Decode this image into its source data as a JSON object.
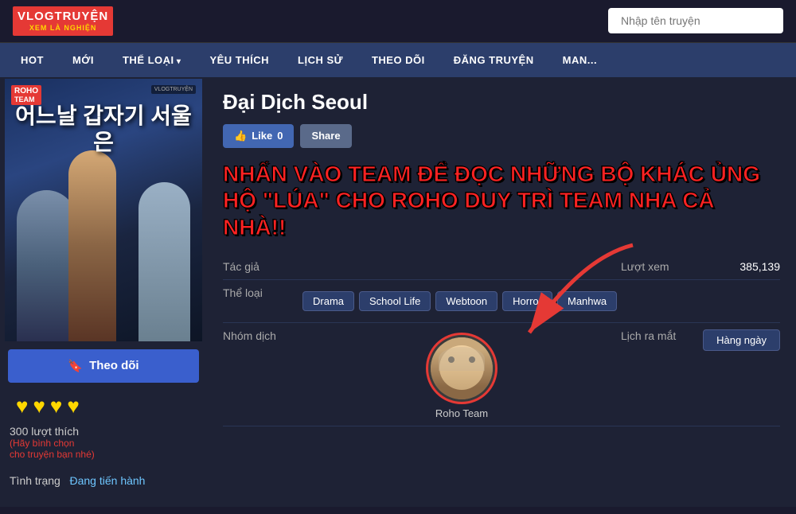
{
  "header": {
    "logo_top": "VLOGTRUYỆN",
    "logo_bottom": "XEM LÀ NGHIỆN",
    "search_placeholder": "Nhập tên truyện"
  },
  "nav": {
    "items": [
      {
        "label": "HOT",
        "has_arrow": false
      },
      {
        "label": "MỚI",
        "has_arrow": false
      },
      {
        "label": "THỂ LOẠI",
        "has_arrow": true
      },
      {
        "label": "YÊU THÍCH",
        "has_arrow": false
      },
      {
        "label": "LỊCH SỬ",
        "has_arrow": false
      },
      {
        "label": "THEO DÕI",
        "has_arrow": false
      },
      {
        "label": "ĐĂNG TRUYỆN",
        "has_arrow": false
      },
      {
        "label": "MAN...",
        "has_arrow": false
      }
    ]
  },
  "manga": {
    "title": "Đại Dịch Seoul",
    "cover_title": "어느날\n갑자기\n서울은",
    "cover_badge_top": "ROHO",
    "cover_badge_bottom": "TEAM",
    "watermark": "VLOGTRUYỆN",
    "like_count": "0",
    "like_label": "Like",
    "share_label": "Share",
    "promo_text": "NHẤN VÀO TEAM ĐỂ ĐỌC NHỮNG BỘ KHÁC ỦNG HỘ \"LÚA\" CHO ROHO DUY TRÌ TEAM NHA CẢ NHÀ!!",
    "author_label": "Tác giả",
    "author_value": "",
    "views_label": "Lượt xem",
    "views_value": "385,139",
    "genre_label": "Thể loại",
    "genres": [
      "Drama",
      "School Life",
      "Webtoon",
      "Horror",
      "Manhwa"
    ],
    "group_label": "Nhóm dịch",
    "group_name": "Roho Team",
    "schedule_label": "Lịch ra mắt",
    "schedule_value": "Hàng ngày",
    "follow_label": "Theo dõi",
    "hearts_count": 4,
    "likes_count": "300 lượt thích",
    "likes_hint": "(Hãy bình chọn\ncho truyện bạn nhé)",
    "status_label": "Tình trạng",
    "status_value": "Đang tiến hành"
  }
}
